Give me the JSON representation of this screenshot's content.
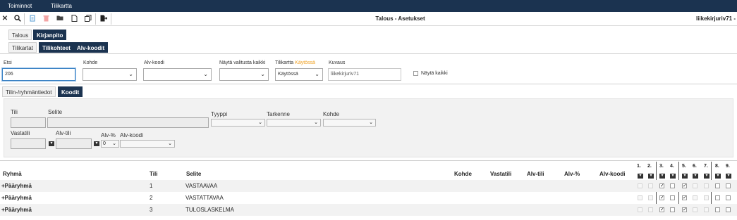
{
  "menu": {
    "items": [
      "Toiminnot",
      "Tilikartta"
    ]
  },
  "window": {
    "title": "Talous - Asetukset",
    "user": "liikekirjuriv71 -"
  },
  "tabs_main": [
    "Talous",
    "Kirjanpito"
  ],
  "tabs_sub": [
    "Tilikartat",
    "Tilikohteet",
    "Alv-koodit"
  ],
  "filters": {
    "etsi_label": "Etsi",
    "etsi_value": "206",
    "kohde_label": "Kohde",
    "alvkoodi_label": "Alv-koodi",
    "nayta_valitusta_label": "Näytä valitusta kaikki",
    "tilikartta_label": "Tilikartta",
    "tilikartta_status": "Käytössä",
    "tilikartta_value": "Käytössä",
    "kuvaus_label": "Kuvaus",
    "kuvaus_value": "liikekirjuriv71",
    "nayta_kaikki_label": "Näytä kaikki"
  },
  "detail_tabs": [
    "Tilin-/ryhmäntiedot",
    "Koodit"
  ],
  "detail": {
    "tili": "Tili",
    "selite": "Selite",
    "tyyppi": "Tyyppi",
    "tarkenne": "Tarkenne",
    "kohde": "Kohde",
    "vastatili": "Vastatili",
    "alvtili": "Alv-tili",
    "alvpct": "Alv-%",
    "alvkoodi": "Alv-koodi",
    "alvpct_value": "0"
  },
  "table": {
    "columns": [
      "Ryhmä",
      "Tili",
      "Selite",
      "Kohde",
      "Vastatili",
      "Alv-tili",
      "Alv-%",
      "Alv-koodi"
    ],
    "num_columns": [
      "1.",
      "2.",
      "3.",
      "4.",
      "5.",
      "6.",
      "7.",
      "8.",
      "9."
    ],
    "rows": [
      {
        "ryhma": "+Pääryhmä",
        "tili": "1",
        "selite": "VASTAAVAA"
      },
      {
        "ryhma": "+Pääryhmä",
        "tili": "2",
        "selite": "VASTATTAVAA"
      },
      {
        "ryhma": "+Pääryhmä",
        "tili": "3",
        "selite": "TULOSLASKELMA"
      }
    ]
  },
  "colors": {
    "nav": "#1b3350",
    "accent": "#f0a020",
    "focus": "#3b82c4"
  },
  "icons": [
    "close-icon",
    "search-icon",
    "copy-icon",
    "delete-icon",
    "folder-icon",
    "new-document-icon",
    "duplicate-icon",
    "export-icon"
  ]
}
